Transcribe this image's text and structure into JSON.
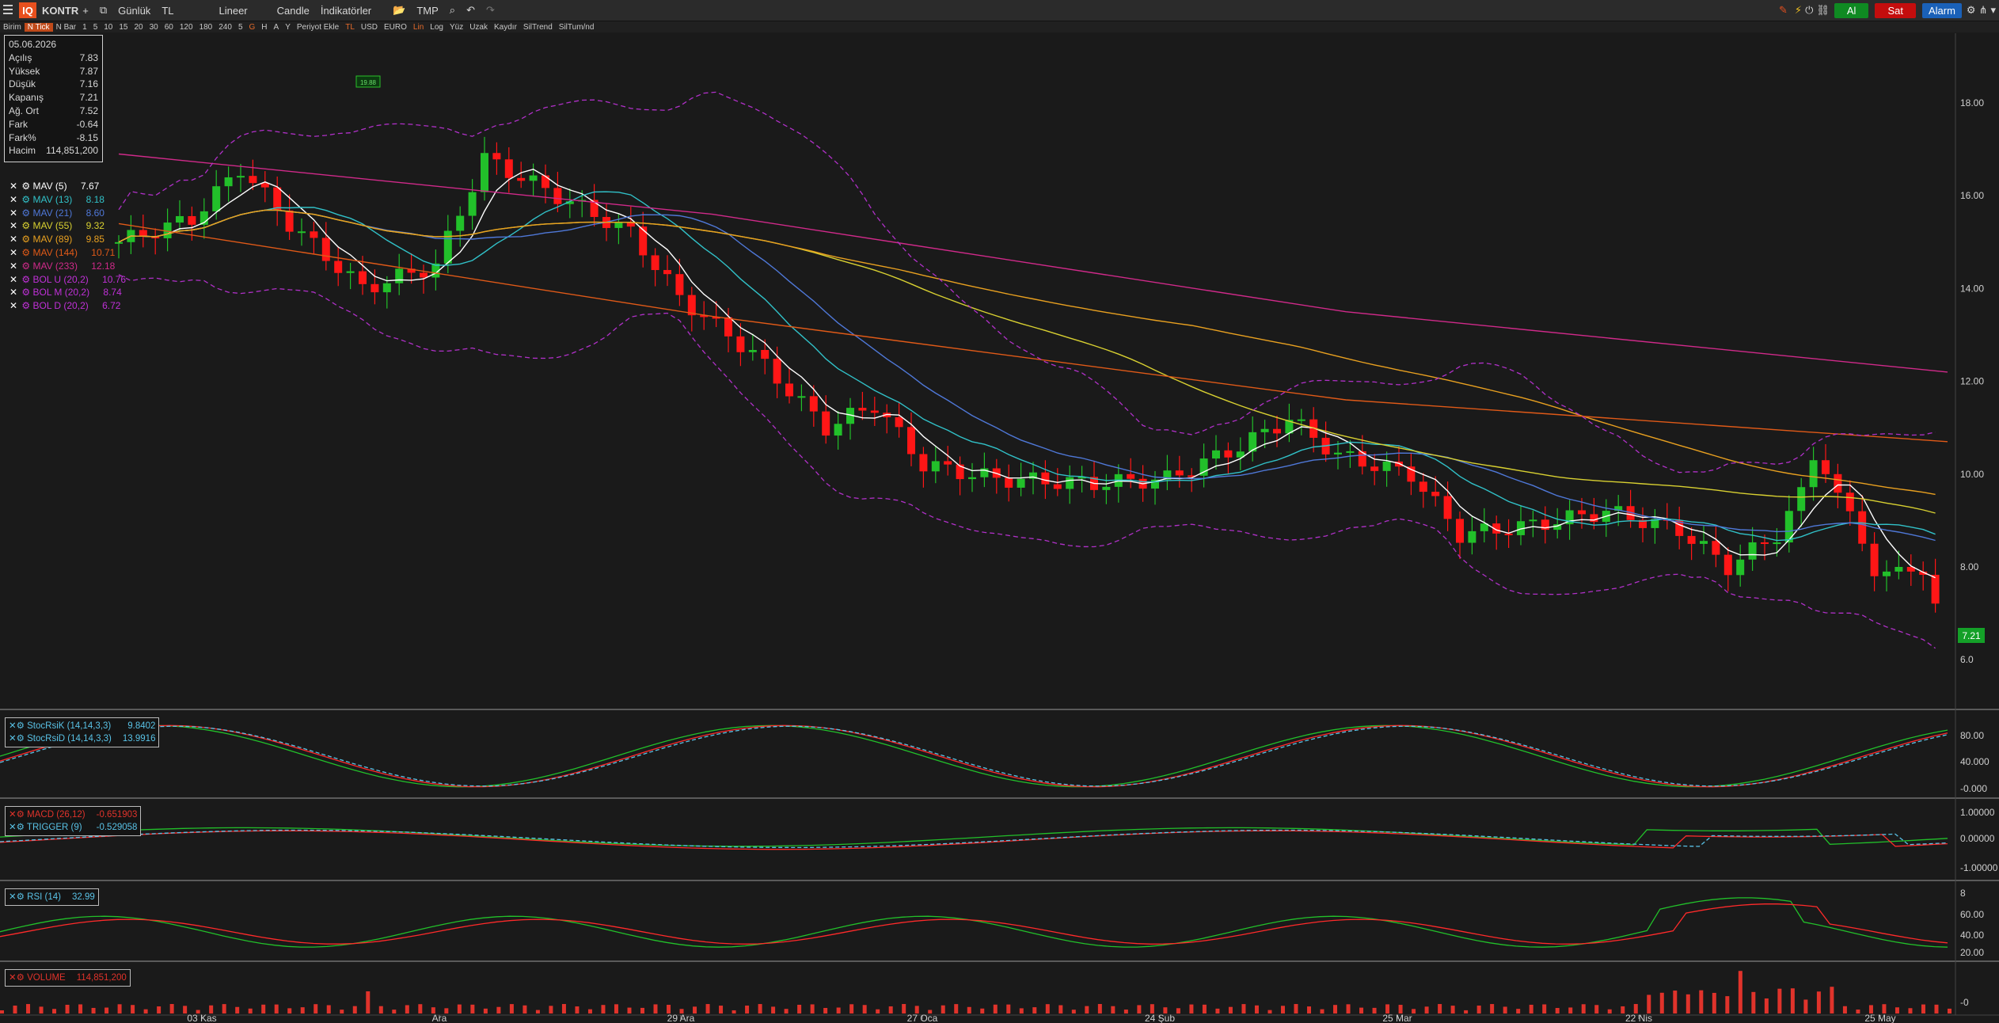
{
  "toolbar": {
    "logo": "IQ",
    "symbol": "KONTR",
    "plus": "+",
    "period": "Günlük",
    "currency": "TL",
    "scale": "Lineer",
    "chart_type": "Candle",
    "indicators": "İndikatörler",
    "template": "TMP",
    "buy": "Al",
    "sell": "Sat",
    "alarm": "Alarm"
  },
  "subtoolbar": {
    "items": [
      "Birim",
      "N Tick",
      "N Bar",
      "1",
      "5",
      "10",
      "15",
      "20",
      "30",
      "60",
      "120",
      "180",
      "240",
      "5",
      "G",
      "H",
      "A",
      "Y",
      "Periyot Ekle",
      "TL",
      "USD",
      "EURO",
      "Lin",
      "Log",
      "Yüz",
      "Uzak",
      "Kaydır",
      "SilTrend",
      "SilTum/nd"
    ]
  },
  "info": {
    "date": "05.06.2026",
    "rows": [
      {
        "label": "Açılış",
        "value": "7.83"
      },
      {
        "label": "Yüksek",
        "value": "7.87"
      },
      {
        "label": "Düşük",
        "value": "7.16"
      },
      {
        "label": "Kapanış",
        "value": "7.21"
      },
      {
        "label": "Ağ. Ort",
        "value": "7.52"
      },
      {
        "label": "Fark",
        "value": "-0.64"
      },
      {
        "label": "Fark%",
        "value": "-8.15"
      },
      {
        "label": "Hacim",
        "value": "114,851,200"
      }
    ]
  },
  "overlays": [
    {
      "name": "MAV (5)",
      "value": "7.67",
      "color": "#ffffff"
    },
    {
      "name": "MAV (13)",
      "value": "8.18",
      "color": "#31c1c8"
    },
    {
      "name": "MAV (21)",
      "value": "8.60",
      "color": "#4f78d8"
    },
    {
      "name": "MAV (55)",
      "value": "9.32",
      "color": "#d8d031"
    },
    {
      "name": "MAV (89)",
      "value": "9.85",
      "color": "#e8a020"
    },
    {
      "name": "MAV (144)",
      "value": "10.71",
      "color": "#e05a18"
    },
    {
      "name": "MAV (233)",
      "value": "12.18",
      "color": "#d02a8a"
    },
    {
      "name": "BOL U (20,2)",
      "value": "10.76",
      "color": "#c030d8"
    },
    {
      "name": "BOL M (20,2)",
      "value": "8.74",
      "color": "#c030d8"
    },
    {
      "name": "BOL D (20,2)",
      "value": "6.72",
      "color": "#c030d8"
    }
  ],
  "last_price": "7.21",
  "price_axis": [
    "18.00",
    "16.00",
    "14.00",
    "12.00",
    "10.00",
    "8.00",
    "6.0"
  ],
  "date_axis": [
    "03 Kas",
    "Ara",
    "29 Ara",
    "27 Oca",
    "24 Şub",
    "25 Mar",
    "22 Nis",
    "25 May"
  ],
  "annotation": "19.88",
  "panels": {
    "stoch": {
      "rows": [
        {
          "name": "StocRsiK (14,14,3,3)",
          "value": "9.8402",
          "color": "#59c2e6"
        },
        {
          "name": "StocRsiD (14,14,3,3)",
          "value": "13.9916",
          "color": "#59c2e6"
        }
      ],
      "axis": [
        "80.00",
        "40.000",
        "-0.000"
      ]
    },
    "macd": {
      "rows": [
        {
          "name": "MACD (26,12)",
          "value": "-0.651903",
          "color": "#e0332b"
        },
        {
          "name": "TRIGGER (9)",
          "value": "-0.529058",
          "color": "#59c2e6"
        }
      ],
      "axis": [
        "1.00000",
        "0.00000",
        "-1.00000"
      ]
    },
    "rsi": {
      "rows": [
        {
          "name": "RSI (14)",
          "value": "32.99",
          "color": "#59c2e6"
        }
      ],
      "axis": [
        "8",
        "60.00",
        "40.00",
        "20.00"
      ]
    },
    "volume": {
      "rows": [
        {
          "name": "VOLUME",
          "value": "114,851,200",
          "color": "#e0332b"
        }
      ],
      "axis": [
        "-0"
      ]
    }
  },
  "colors": {
    "up": "#22c02a",
    "down": "#ff1616",
    "bg": "#1a1a1a",
    "grid": "#2e2e2e"
  }
}
